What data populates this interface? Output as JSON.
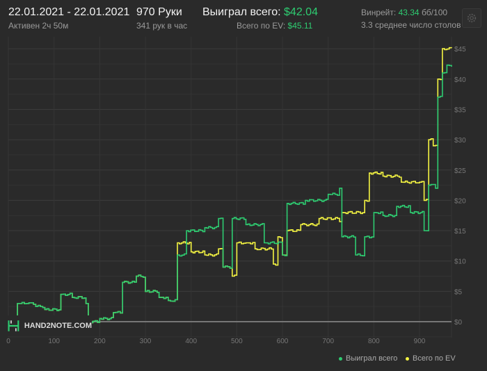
{
  "header": {
    "date_range": "22.01.2021 - 22.01.2021",
    "active": "Активен 2ч 50м",
    "hands": "970 Руки",
    "hands_per_hour": "341 рук в час",
    "won_label": "Выиграл всего:",
    "won_value": "$42.04",
    "ev_label": "Всего по EV:",
    "ev_value": "$45.11",
    "winrate_label": "Винрейт:",
    "winrate_value": "43.34",
    "winrate_unit": "бб/100",
    "tables": "3.3 среднее число столов",
    "settings_icon": "gear-icon"
  },
  "logo_text": "HAND2NOTE.COM",
  "colors": {
    "won": "#2ecc71",
    "ev": "#f5f542",
    "accent": "#2ecc71"
  },
  "chart_data": {
    "type": "line",
    "xlabel": "",
    "ylabel": "",
    "xlim": [
      0,
      970
    ],
    "ylim": [
      -1,
      47
    ],
    "x_ticks": [
      0,
      100,
      200,
      300,
      400,
      500,
      600,
      700,
      800,
      900
    ],
    "x_tick_labels": [
      "0",
      "100",
      "200",
      "300",
      "400",
      "500",
      "600",
      "700",
      "800",
      "900"
    ],
    "y_ticks": [
      0,
      5,
      10,
      15,
      20,
      25,
      30,
      35,
      40,
      45
    ],
    "y_tick_labels": [
      "$0",
      "$5",
      "$10",
      "$15",
      "$20",
      "$25",
      "$30",
      "$35",
      "$40",
      "$45"
    ],
    "grid": true,
    "legend_position": "bottom-right",
    "series": [
      {
        "name": "Выиграл всего",
        "color": "#2ecc71",
        "x": [
          0,
          20,
          40,
          60,
          80,
          115,
          140,
          170,
          175,
          200,
          230,
          250,
          280,
          300,
          330,
          350,
          370,
          390,
          430,
          460,
          470,
          490,
          520,
          560,
          600,
          610,
          650,
          700,
          725,
          730,
          760,
          780,
          800,
          820,
          850,
          880,
          910,
          920,
          935,
          940,
          950,
          960,
          970
        ],
        "y": [
          0,
          3,
          3,
          2.5,
          2,
          4.5,
          4,
          3,
          0,
          0.5,
          1.5,
          6.5,
          7.5,
          5,
          4,
          3.5,
          11,
          15,
          15.5,
          17,
          9,
          17,
          16,
          13,
          11,
          19.5,
          20,
          21,
          22,
          14,
          11,
          14,
          18,
          17.5,
          19,
          18,
          15,
          22.5,
          22,
          37,
          41,
          42.3,
          42.04
        ]
      },
      {
        "name": "Всего по EV",
        "color": "#f5f542",
        "x": [
          0,
          20,
          40,
          60,
          80,
          115,
          140,
          170,
          175,
          200,
          230,
          250,
          280,
          300,
          330,
          350,
          370,
          400,
          430,
          460,
          470,
          490,
          500,
          520,
          540,
          580,
          590,
          600,
          610,
          640,
          680,
          725,
          730,
          780,
          790,
          820,
          860,
          900,
          910,
          920,
          930,
          940,
          950,
          970
        ],
        "y": [
          0,
          3,
          3,
          2.5,
          2,
          4.5,
          4,
          3,
          0,
          0.5,
          1.5,
          6.5,
          7.5,
          5,
          4,
          3.5,
          13,
          11.5,
          11,
          12,
          9,
          7.5,
          13,
          13,
          12,
          9.5,
          14,
          11,
          15,
          16,
          17,
          16.5,
          18,
          20,
          24.5,
          24,
          23,
          23,
          20,
          30,
          29,
          40,
          45,
          45.11
        ]
      }
    ]
  },
  "legend": [
    "Выиграл всего",
    "Всего по EV"
  ]
}
